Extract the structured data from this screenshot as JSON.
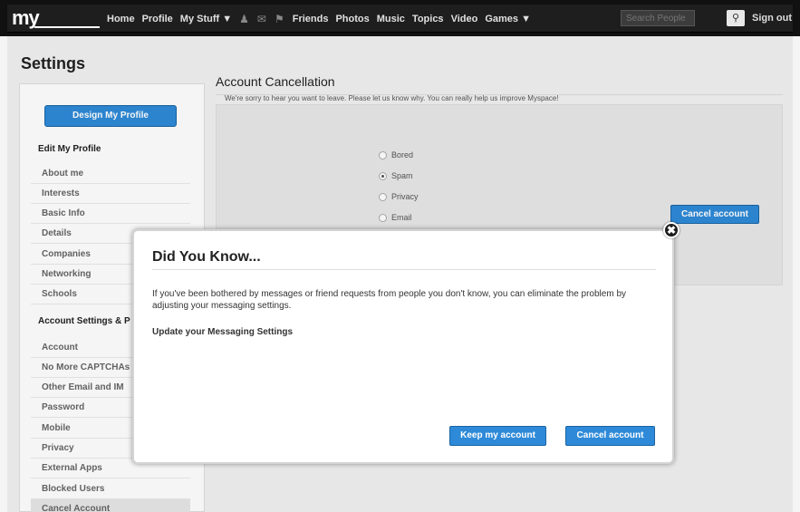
{
  "nav": {
    "logo": "my",
    "links": [
      "Home",
      "Profile",
      "My Stuff ▼"
    ],
    "icons": [
      "person-icon",
      "mail-icon",
      "flag-icon"
    ],
    "links2": [
      "Friends",
      "Photos",
      "Music",
      "Topics",
      "Video",
      "Games ▼"
    ],
    "search_placeholder": "Search People",
    "search_icon": "search-icon",
    "signout": "Sign out"
  },
  "page": {
    "title": "Settings",
    "design_button": "Design My Profile",
    "edit_profile_header": "Edit My Profile",
    "edit_profile_items": [
      "About me",
      "Interests",
      "Basic Info",
      "Details",
      "Companies",
      "Networking",
      "Schools"
    ],
    "account_settings_header": "Account Settings & P",
    "account_items": [
      "Account",
      "No More CAPTCHAs",
      "Other Email and IM",
      "Password",
      "Mobile",
      "Privacy",
      "External Apps",
      "Blocked Users",
      "Cancel Account"
    ]
  },
  "cancellation": {
    "title": "Account Cancellation",
    "prompt": "We're sorry to hear you want to leave. Please let us know why. You can really help us improve Myspace!",
    "options": [
      "Bored",
      "Spam",
      "Privacy",
      "Email"
    ],
    "selected": "Spam",
    "cancel_button": "Cancel account"
  },
  "modal": {
    "title": "Did You Know...",
    "body": "If you've been bothered by messages or friend requests from people you don't know, you can eliminate the problem by adjusting your messaging settings.",
    "link": "Update your Messaging Settings",
    "keep_button": "Keep my account",
    "cancel_button": "Cancel account",
    "close_icon": "close-icon"
  }
}
